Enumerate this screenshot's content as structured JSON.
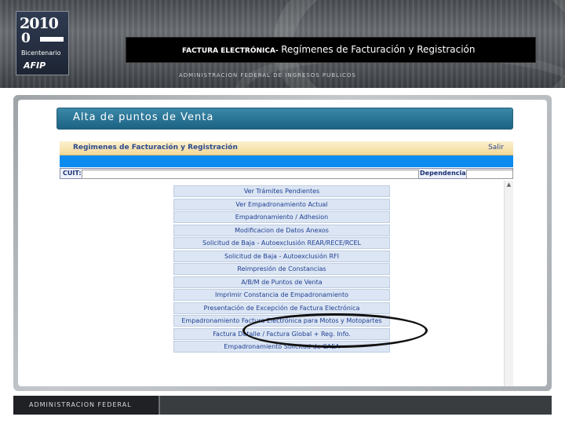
{
  "header": {
    "logo_year": "2010",
    "logo_zero": "0",
    "logo_word": "Bicentenario",
    "logo_mark": "AFIP",
    "title_prefix": "FACTURA ELECTRÓNICA-",
    "title_main": "Regímenes de Facturación y Registración",
    "subline": "ADMINISTRACION FEDERAL DE INGRESOS PUBLICOS"
  },
  "section": {
    "title": "Alta de puntos de Venta"
  },
  "app": {
    "title": "Regimenes de Facturación y Registración",
    "salir_label": "Salir",
    "cuit_label": "CUIT:",
    "cuit_value": "",
    "dependencia_label": "Dependencia:",
    "dependencia_value": "",
    "menu": [
      "Ver Trámites Pendientes",
      "Ver Empadronamiento Actual",
      "Empadronamiento / Adhesion",
      "Modificacion de Datos Anexos",
      "Solicitud de Baja - Autoexclusión REAR/RECE/RCEL",
      "Solicitud de Baja - Autoexclusión RFI",
      "Reimpresión de Constancias",
      "A/B/M de Puntos de Venta",
      "Imprimir Constancia de Empadronamiento",
      "Presentación de Excepción de Factura Electrónica",
      "Empadronamiento Factura Electrónica para Motos y Motopartes",
      "Factura Detalle / Factura Global + Reg. Info.",
      "Empadronamiento Solicitud de CAEA"
    ]
  },
  "footer": {
    "label": "ADMINISTRACION FEDERAL"
  },
  "colors": {
    "banner": "#1c6283",
    "menu_bg": "#dbe5f3",
    "menu_text": "#1f3f93",
    "blue_strip": "#0d8cf0"
  }
}
